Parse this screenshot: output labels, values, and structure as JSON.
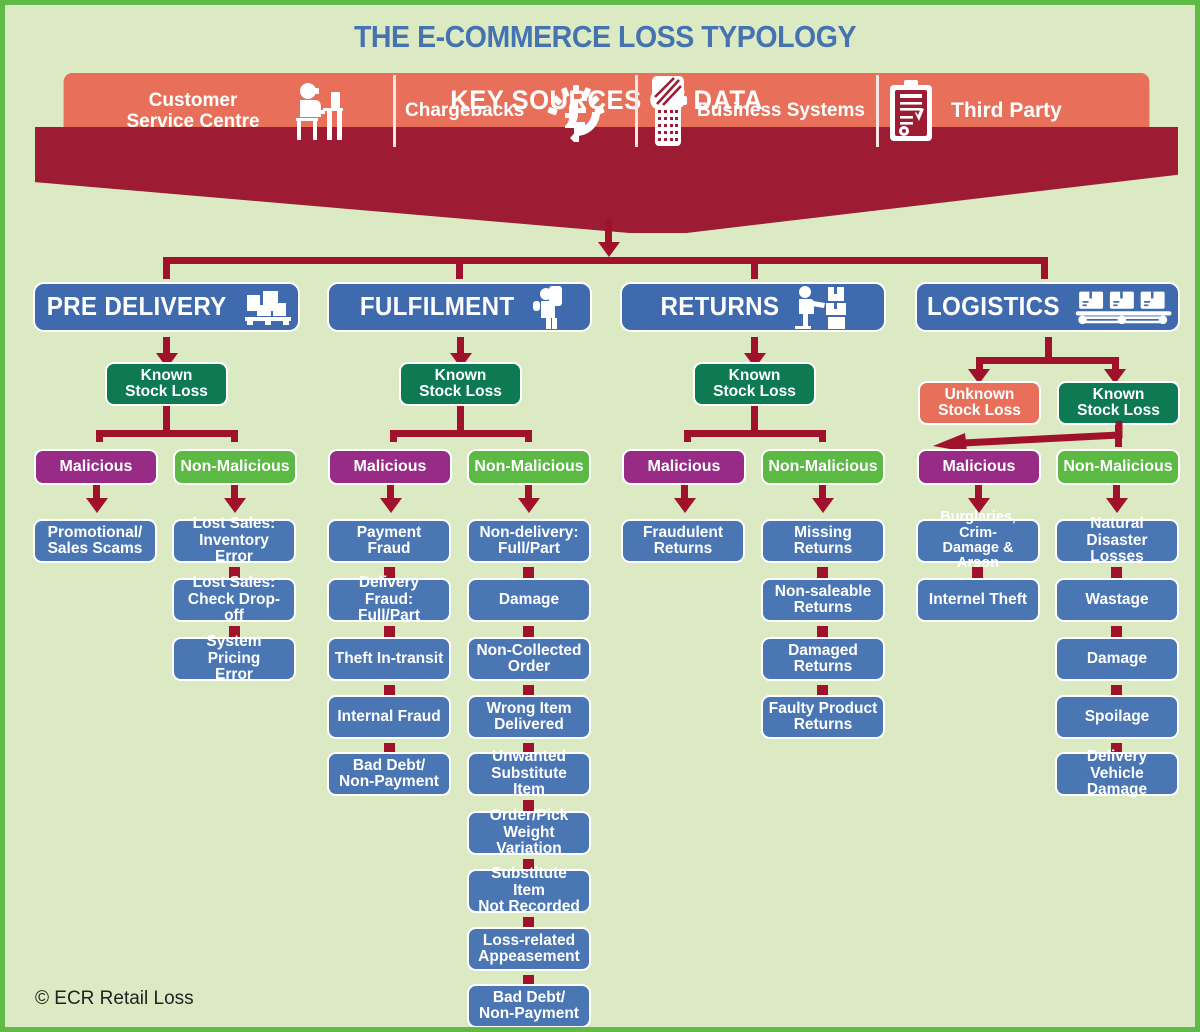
{
  "title": "THE E-COMMERCE LOSS TYPOLOGY",
  "colors": {
    "background": "#dceac4",
    "border": "#5fbb46",
    "title": "#4572b0",
    "banner_top": "#e8705a",
    "banner_body": "#9e1b34",
    "connector": "#a0122c",
    "category": "#3f6aad",
    "known": "#0d7a54",
    "unknown": "#e8705a",
    "malicious": "#972b86",
    "non_malicious": "#5cb944",
    "leaf": "#4a76b4"
  },
  "banner": {
    "heading": "KEY SOURCES OF DATA",
    "sources": [
      {
        "label": "Customer\nService Centre",
        "icon": "agent-at-desk-icon"
      },
      {
        "label": "Chargebacks",
        "icon": "pound-refund-icon"
      },
      {
        "label": "Business Systems",
        "icon": "handheld-scanner-icon"
      },
      {
        "label": "Third Party",
        "icon": "clipboard-icon"
      }
    ]
  },
  "columns": [
    {
      "name": "PRE DELIVERY",
      "icon": "pallet-boxes-icon",
      "stock_loss": [
        {
          "label": "Known\nStock Loss",
          "kind": "known"
        }
      ],
      "malicious": {
        "label": "Malicious",
        "items": [
          "Promotional/\nSales Scams"
        ]
      },
      "non_malicious": {
        "label": "Non-Malicious",
        "items": [
          "Lost Sales:\nInventory Error",
          "Lost Sales:\nCheck Drop-off",
          "System Pricing\nError"
        ]
      }
    },
    {
      "name": "FULFILMENT",
      "icon": "picker-scanner-icon",
      "stock_loss": [
        {
          "label": "Known\nStock Loss",
          "kind": "known"
        }
      ],
      "malicious": {
        "label": "Malicious",
        "items": [
          "Payment Fraud",
          "Delivery Fraud:\nFull/Part",
          "Theft In-transit",
          "Internal Fraud",
          "Bad Debt/\nNon-Payment"
        ]
      },
      "non_malicious": {
        "label": "Non-Malicious",
        "items": [
          "Non-delivery:\nFull/Part",
          "Damage",
          "Non-Collected\nOrder",
          "Wrong Item\nDelivered",
          "Unwanted\nSubstitute Item",
          "Order/Pick\nWeight Variation",
          "Substitute Item\nNot Recorded",
          "Loss-related\nAppeasement",
          "Bad Debt/\nNon-Payment"
        ]
      }
    },
    {
      "name": "RETURNS",
      "icon": "returns-worker-icon",
      "stock_loss": [
        {
          "label": "Known\nStock Loss",
          "kind": "known"
        }
      ],
      "malicious": {
        "label": "Malicious",
        "items": [
          "Fraudulent\nReturns"
        ]
      },
      "non_malicious": {
        "label": "Non-Malicious",
        "items": [
          "Missing Returns",
          "Non-saleable\nReturns",
          "Damaged\nReturns",
          "Faulty Product\nReturns"
        ]
      }
    },
    {
      "name": "LOGISTICS",
      "icon": "conveyor-boxes-icon",
      "stock_loss": [
        {
          "label": "Unknown\nStock Loss",
          "kind": "unknown"
        },
        {
          "label": "Known\nStock Loss",
          "kind": "known"
        }
      ],
      "malicious": {
        "label": "Malicious",
        "items": [
          "Burglaries, Crim-\nDamage & Arson",
          "Internel Theft"
        ]
      },
      "non_malicious": {
        "label": "Non-Malicious",
        "items": [
          "Natural Disaster\nLosses",
          "Wastage",
          "Damage",
          "Spoilage",
          "Delivery Vehicle\nDamage"
        ]
      }
    }
  ],
  "footer": "© ECR Retail Loss"
}
